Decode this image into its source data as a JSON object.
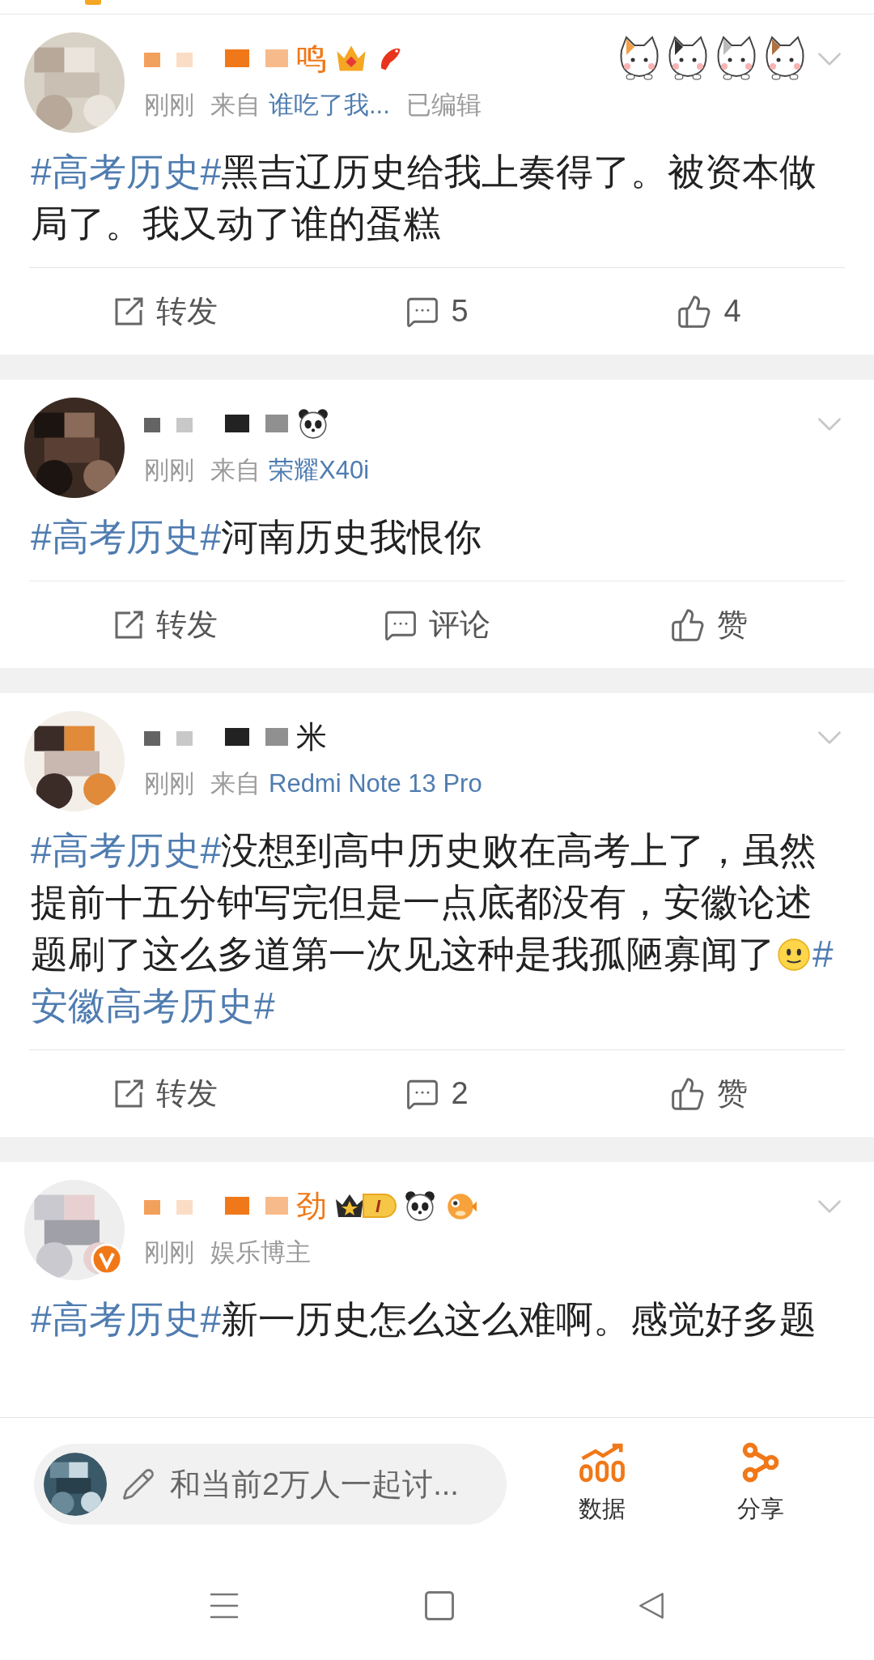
{
  "posts": [
    {
      "author": {
        "name": "鸣",
        "color": "#f07818"
      },
      "badges": [
        {
          "kind": "crown"
        },
        {
          "kind": "koi"
        },
        {
          "kind": "cats"
        }
      ],
      "avatar": {
        "verified": false
      },
      "meta": [
        {
          "kind": "plain",
          "text": "刚刚"
        },
        {
          "kind": "plain",
          "text": "来自"
        },
        {
          "kind": "link",
          "text": "谁吃了我..."
        },
        {
          "kind": "plain",
          "text": "已编辑"
        }
      ],
      "body": [
        {
          "kind": "topic",
          "text": "#高考历史#"
        },
        {
          "kind": "text",
          "text": "黑吉辽历史给我上奏得了。被资本做局了。我又动了谁的蛋糕"
        }
      ],
      "actions": [
        {
          "kind": "repost",
          "label": "转发"
        },
        {
          "kind": "comment",
          "label": "5"
        },
        {
          "kind": "like",
          "label": "4"
        }
      ]
    },
    {
      "author": {
        "color": "#222222"
      },
      "badges": [
        {
          "kind": "panda"
        }
      ],
      "avatar": {
        "verified": false
      },
      "meta": [
        {
          "kind": "plain",
          "text": "刚刚"
        },
        {
          "kind": "plain",
          "text": "来自"
        },
        {
          "kind": "link",
          "text": "荣耀X40i"
        }
      ],
      "body": [
        {
          "kind": "topic",
          "text": "#高考历史#"
        },
        {
          "kind": "text",
          "text": "河南历史我恨你"
        }
      ],
      "actions": [
        {
          "kind": "repost",
          "label": "转发"
        },
        {
          "kind": "comment",
          "label": "评论"
        },
        {
          "kind": "like",
          "label": "赞"
        }
      ]
    },
    {
      "author": {
        "name": "米",
        "color": "#222222"
      },
      "avatar": {
        "verified": false
      },
      "meta": [
        {
          "kind": "plain",
          "text": "刚刚"
        },
        {
          "kind": "plain",
          "text": "来自"
        },
        {
          "kind": "link",
          "text": "Redmi Note 13 Pro"
        }
      ],
      "body": [
        {
          "kind": "topic",
          "text": "#高考历史#"
        },
        {
          "kind": "text",
          "text": "没想到高中历史败在高考上了，虽然提前十五分钟写完但是一点底都没有，安徽论述题刷了这么多道第一次见这种是我孤陋寡闻了"
        },
        {
          "kind": "emoji"
        },
        {
          "kind": "topic",
          "text": "#安徽高考历史#"
        }
      ],
      "actions": [
        {
          "kind": "repost",
          "label": "转发"
        },
        {
          "kind": "comment",
          "label": "2"
        },
        {
          "kind": "like",
          "label": "赞"
        }
      ]
    },
    {
      "author": {
        "name": "劲",
        "color": "#f07818"
      },
      "badges": [
        {
          "kind": "vip",
          "text": "I"
        },
        {
          "kind": "panda"
        },
        {
          "kind": "puffer"
        }
      ],
      "avatar": {
        "verified": true
      },
      "meta": [
        {
          "kind": "plain",
          "text": "刚刚"
        },
        {
          "kind": "plain",
          "text": "娱乐博主"
        }
      ],
      "body": [
        {
          "kind": "topic",
          "text": "#高考历史#"
        },
        {
          "kind": "text",
          "text": "新一历史怎么这么难啊。感觉好多题"
        }
      ]
    }
  ],
  "bottom_bar": {
    "comment_placeholder": "和当前2万人一起讨...",
    "buttons": [
      {
        "kind": "data",
        "label": "数据"
      },
      {
        "kind": "share",
        "label": "分享"
      }
    ]
  },
  "nav_bar": [
    {
      "kind": "menu"
    },
    {
      "kind": "home"
    },
    {
      "kind": "back"
    }
  ]
}
